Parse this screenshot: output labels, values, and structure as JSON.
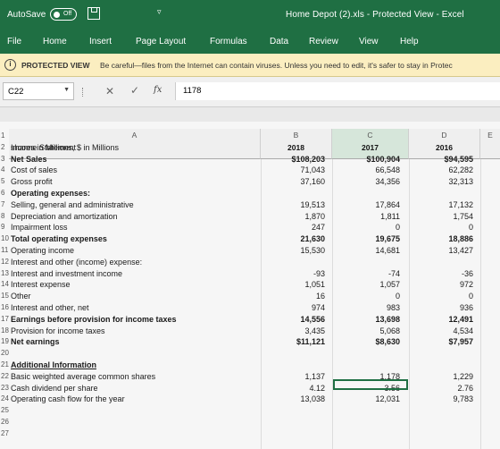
{
  "titlebar": {
    "autosave_label": "AutoSave",
    "autosave_state": "Off",
    "qat_arrow": "▿",
    "document_title": "Home Depot (2).xls  -  Protected View  -  Excel"
  },
  "ribbon_tabs": [
    "File",
    "Home",
    "Insert",
    "Page Layout",
    "Formulas",
    "Data",
    "Review",
    "View",
    "Help"
  ],
  "protected_bar": {
    "icon": "i",
    "label": "PROTECTED VIEW",
    "message": "Be careful—files from the Internet can contain viruses. Unless you need to edit, it's safer to stay in Protec"
  },
  "formula_bar": {
    "name_box": "C22",
    "cancel_glyph": "✕",
    "enter_glyph": "✓",
    "fx_glyph": "fx",
    "formula": "1178"
  },
  "columns": [
    {
      "letter": "A",
      "year": "shares in Millions, $ in Millions"
    },
    {
      "letter": "B",
      "year": "2018"
    },
    {
      "letter": "C",
      "year": "2017"
    },
    {
      "letter": "D",
      "year": "2016"
    },
    {
      "letter": "E",
      "year": ""
    }
  ],
  "rows": [
    {
      "num": "1",
      "label": "shares in Millions, $ in Millions",
      "bold": false,
      "b": "2018",
      "c": "2017",
      "d": "2016"
    },
    {
      "num": "2",
      "label": "Income Statement",
      "bold": false,
      "b": "",
      "c": "",
      "d": ""
    },
    {
      "num": "3",
      "label": "Net Sales",
      "bold": true,
      "b": "$108,203",
      "c": "$100,904",
      "d": "$94,595"
    },
    {
      "num": "4",
      "label": "Cost of sales",
      "bold": false,
      "b": "71,043",
      "c": "66,548",
      "d": "62,282"
    },
    {
      "num": "5",
      "label": "Gross profit",
      "bold": false,
      "b": "37,160",
      "c": "34,356",
      "d": "32,313"
    },
    {
      "num": "6",
      "label": "Operating expenses:",
      "bold": true,
      "b": "",
      "c": "",
      "d": ""
    },
    {
      "num": "7",
      "label": "Selling, general and administrative",
      "bold": false,
      "b": "19,513",
      "c": "17,864",
      "d": "17,132"
    },
    {
      "num": "8",
      "label": "Depreciation and amortization",
      "bold": false,
      "b": "1,870",
      "c": "1,811",
      "d": "1,754"
    },
    {
      "num": "9",
      "label": "Impairment loss",
      "bold": false,
      "b": "247",
      "c": "0",
      "d": "0"
    },
    {
      "num": "10",
      "label": "Total operating expenses",
      "bold": true,
      "b": "21,630",
      "c": "19,675",
      "d": "18,886"
    },
    {
      "num": "11",
      "label": "Operating income",
      "bold": false,
      "b": "15,530",
      "c": "14,681",
      "d": "13,427"
    },
    {
      "num": "12",
      "label": "Interest and other (income) expense:",
      "bold": false,
      "b": "",
      "c": "",
      "d": ""
    },
    {
      "num": "13",
      "label": "Interest and investment income",
      "bold": false,
      "b": "-93",
      "c": "-74",
      "d": "-36"
    },
    {
      "num": "14",
      "label": "Interest expense",
      "bold": false,
      "b": "1,051",
      "c": "1,057",
      "d": "972"
    },
    {
      "num": "15",
      "label": "Other",
      "bold": false,
      "b": "16",
      "c": "0",
      "d": "0"
    },
    {
      "num": "16",
      "label": "Interest and other, net",
      "bold": false,
      "b": "974",
      "c": "983",
      "d": "936"
    },
    {
      "num": "17",
      "label": "Earnings before provision for income taxes",
      "bold": true,
      "b": "14,556",
      "c": "13,698",
      "d": "12,491"
    },
    {
      "num": "18",
      "label": "Provision for income taxes",
      "bold": false,
      "b": "3,435",
      "c": "5,068",
      "d": "4,534"
    },
    {
      "num": "19",
      "label": "Net earnings",
      "bold": true,
      "b": "$11,121",
      "c": "$8,630",
      "d": "$7,957"
    },
    {
      "num": "20",
      "label": "",
      "bold": false,
      "b": "",
      "c": "",
      "d": ""
    },
    {
      "num": "21",
      "label": "Additional Information",
      "bold": true,
      "underline": true,
      "b": "",
      "c": "",
      "d": ""
    },
    {
      "num": "22",
      "label": "Basic weighted average common shares",
      "bold": false,
      "b": "1,137",
      "c": "1,178",
      "d": "1,229"
    },
    {
      "num": "23",
      "label": "Cash dividend per share",
      "bold": false,
      "b": "4.12",
      "c": "3.56",
      "d": "2.76"
    },
    {
      "num": "24",
      "label": "Operating cash flow for the year",
      "bold": false,
      "b": "13,038",
      "c": "12,031",
      "d": "9,783"
    },
    {
      "num": "25",
      "label": "",
      "bold": false,
      "b": "",
      "c": "",
      "d": ""
    },
    {
      "num": "26",
      "label": "",
      "bold": false,
      "b": "",
      "c": "",
      "d": ""
    },
    {
      "num": "27",
      "label": "",
      "bold": false,
      "b": "",
      "c": "",
      "d": ""
    }
  ]
}
